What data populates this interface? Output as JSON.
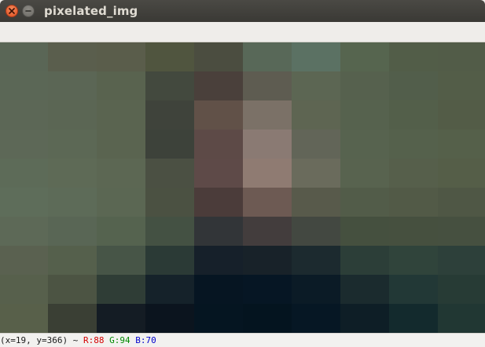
{
  "window": {
    "title": "pixelated_img"
  },
  "status": {
    "coords": "(x=19, y=366) ~ ",
    "r": "R:88",
    "g": "G:94",
    "b": "B:70",
    "colors": {
      "r": "#d40000",
      "g": "#008a00",
      "b": "#0000cc"
    }
  },
  "image": {
    "cols": 10,
    "rows": 10,
    "pixels": [
      [
        "#5a6656",
        "#5a5e4d",
        "#5a5d4b",
        "#50553f",
        "#4b4d40",
        "#586858",
        "#5b7163",
        "#56654f",
        "#525d48",
        "#525c48"
      ],
      [
        "#5b6756",
        "#5b6655",
        "#59634f",
        "#43493e",
        "#4a403b",
        "#5e5c51",
        "#5c6653",
        "#56614e",
        "#525e4b",
        "#535d48"
      ],
      [
        "#5c6756",
        "#5b6654",
        "#5a6450",
        "#3f433b",
        "#615148",
        "#7b7167",
        "#5e6552",
        "#56624e",
        "#535f4a",
        "#535c47"
      ],
      [
        "#5d6857",
        "#5c6855",
        "#5a6450",
        "#3d423a",
        "#5d4a47",
        "#8a7a73",
        "#626558",
        "#57634f",
        "#55614c",
        "#55604a"
      ],
      [
        "#5d6b58",
        "#5e6a56",
        "#5c6753",
        "#4b5043",
        "#5e4a48",
        "#8f7b72",
        "#6a6b5c",
        "#58634f",
        "#565f4b",
        "#555e48"
      ],
      [
        "#5e6d5a",
        "#5d6b58",
        "#5b6753",
        "#4b5142",
        "#4b3c3a",
        "#6d5a53",
        "#585a4b",
        "#525c49",
        "#525a47",
        "#4f5745"
      ],
      [
        "#5d6957",
        "#596655",
        "#55634f",
        "#445143",
        "#323538",
        "#433d3d",
        "#434841",
        "#45503f",
        "#46503f",
        "#465040"
      ],
      [
        "#5a6150",
        "#55604c",
        "#475547",
        "#2b3a36",
        "#16202a",
        "#182229",
        "#1c2a2f",
        "#2c3e38",
        "#30443b",
        "#2d403a"
      ],
      [
        "#57604c",
        "#4c5443",
        "#2f3d36",
        "#15222a",
        "#061522",
        "#061624",
        "#0b1b26",
        "#1b2b2e",
        "#223836",
        "#273b35"
      ],
      [
        "#58604a",
        "#3a3f34",
        "#141c24",
        "#0b141e",
        "#051521",
        "#04141f",
        "#061724",
        "#0e1e26",
        "#132a2d",
        "#213733"
      ]
    ]
  }
}
